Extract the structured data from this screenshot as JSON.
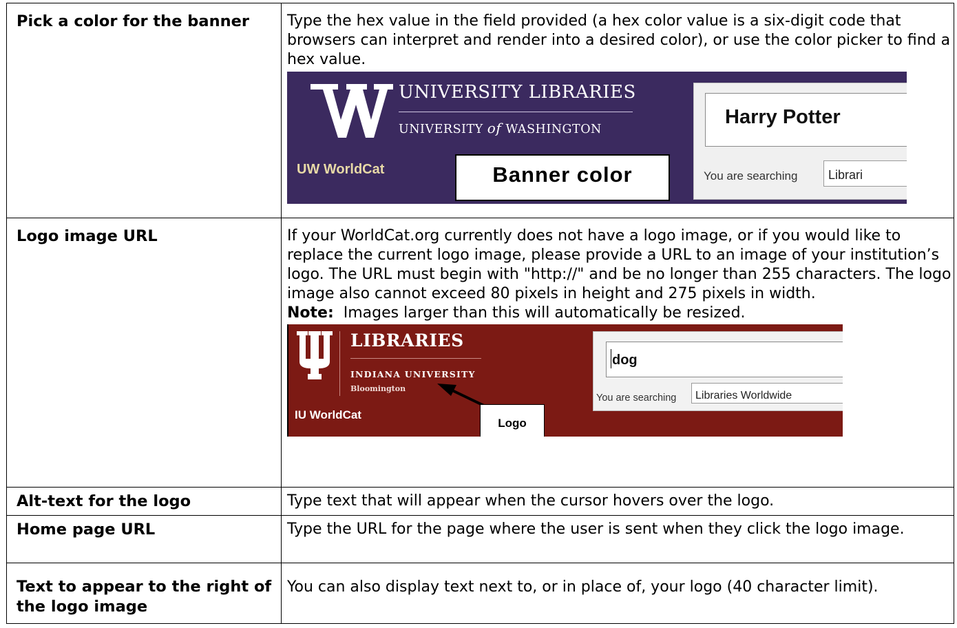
{
  "rows": [
    {
      "label": "Pick a color for the banner",
      "description": "Type the hex value in the field provided (a hex color value is a six-digit code that browsers can interpret and render into a desired color), or use the color picker to find a hex value.",
      "screenshot": {
        "banner_color": "#3b2a5f",
        "logo_letter": "W",
        "title": "UNIVERSITY LIBRARIES",
        "subtitle_pre": "UNIVERSITY",
        "subtitle_of": "of",
        "subtitle_post": "WASHINGTON",
        "worldcat_label": "UW WorldCat",
        "callout": "Banner color",
        "search_value": "Harry Potter",
        "searching_label": "You are searching",
        "searching_value": "Librari"
      }
    },
    {
      "label": "Logo image URL",
      "description": "If your WorldCat.org currently does not have a logo image, or if you would like to replace the current logo image, please provide a URL to an image of your institution’s logo. The URL must begin with \"http://\" and be no longer than 255 characters. The logo image also cannot exceed 80 pixels in height and 275 pixels in width.",
      "note_label": "Note:",
      "note_text": "Images larger than this will automatically be resized.",
      "screenshot": {
        "banner_color": "#7c1a14",
        "title": "LIBRARIES",
        "subtitle": "INDIANA UNIVERSITY",
        "campus": "Bloomington",
        "worldcat_label": "IU WorldCat",
        "callout": "Logo",
        "search_value": "dog",
        "searching_label": "You are searching",
        "searching_value": "Libraries Worldwide"
      }
    },
    {
      "label": "Alt-text for the logo",
      "description": "Type text that will appear when the cursor hovers over the logo."
    },
    {
      "label": "Home page URL",
      "description": "Type the URL for the page where the user is sent when they click the logo image."
    },
    {
      "label": "Text to appear to the right of the logo image",
      "description": "You can also display text next to, or in place of, your logo (40 character limit)."
    }
  ]
}
